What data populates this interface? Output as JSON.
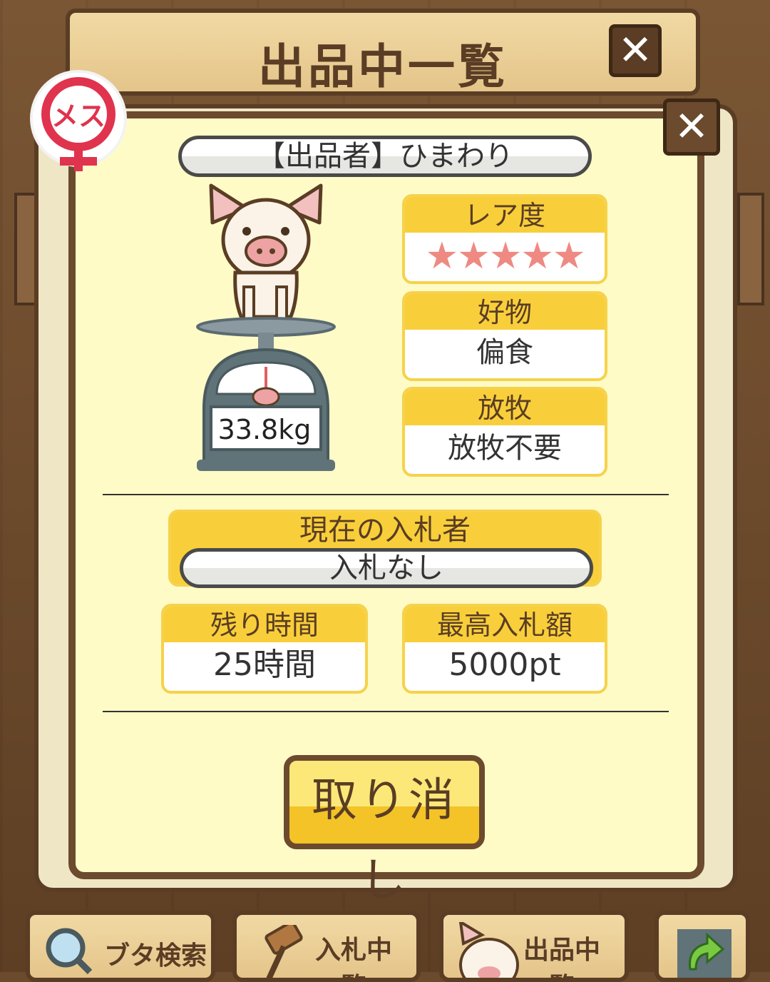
{
  "header": {
    "title": "出品中一覧"
  },
  "listing": {
    "seller_label": "【出品者】ひまわり",
    "gender_label": "メス",
    "weight": "33.8kg",
    "rarity": {
      "label": "レア度",
      "stars": "★★★★★",
      "rating": 5,
      "max": 5
    },
    "favorite": {
      "label": "好物",
      "value": "偏食"
    },
    "grazing": {
      "label": "放牧",
      "value": "放牧不要"
    },
    "current_bidder": {
      "label": "現在の入札者",
      "value": "入札なし"
    },
    "time_left": {
      "label": "残り時間",
      "value": "25時間"
    },
    "highest_bid": {
      "label": "最高入札額",
      "value": "5000pt"
    },
    "cancel_label": "取り消し"
  },
  "nav": {
    "search": "ブタ検索",
    "bidding": "入札中一覧",
    "listing": "出品中一覧"
  },
  "colors": {
    "panel": "#fffbc7",
    "accent_yellow": "#f8cf3a",
    "frame_brown": "#6b4a2e",
    "star_pink": "#ee8a82",
    "gender_red": "#e0334d"
  }
}
